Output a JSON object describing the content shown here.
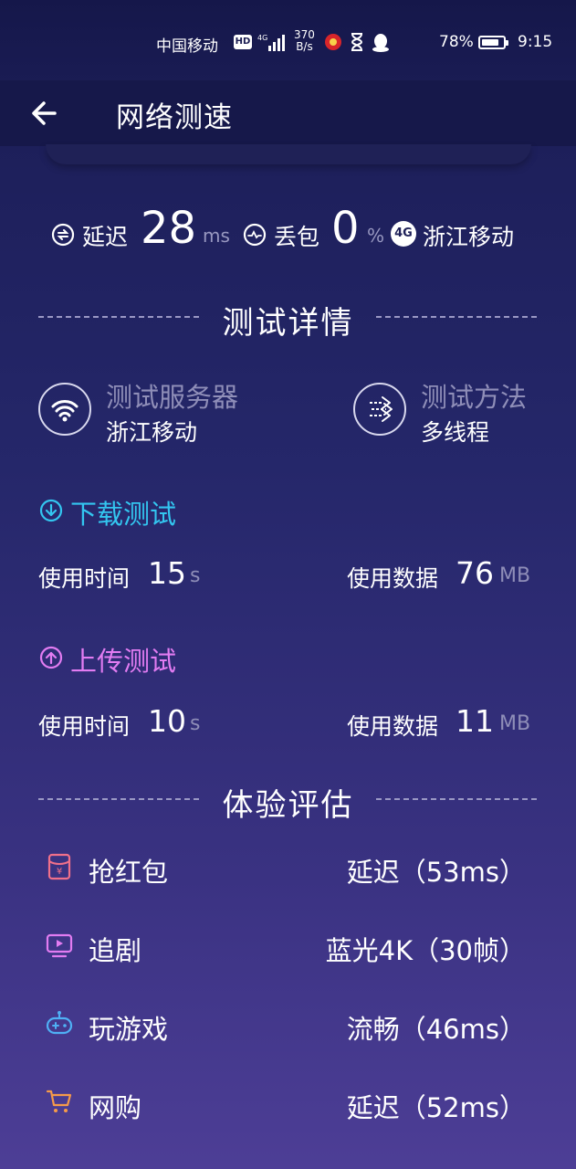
{
  "status_bar": {
    "carrier": "中国移动",
    "hd_badge": "HD",
    "network": "4G",
    "speed_value": "370",
    "speed_unit": "B/s",
    "battery_percent": "78%",
    "time": "9:15"
  },
  "header": {
    "title": "网络测速"
  },
  "metrics": {
    "latency_label": "延迟",
    "latency_value": "28",
    "latency_unit": "ms",
    "packet_loss_label": "丢包",
    "packet_loss_value": "0",
    "packet_loss_unit": "%",
    "network_badge": "4G",
    "operator": "浙江移动"
  },
  "details_section": {
    "title": "测试详情",
    "server_label": "测试服务器",
    "server_value": "浙江移动",
    "method_label": "测试方法",
    "method_value": "多线程"
  },
  "download": {
    "title": "下载测试",
    "color": "#33c6f0",
    "time_label": "使用时间",
    "time_value": "15",
    "time_unit": "s",
    "data_label": "使用数据",
    "data_value": "76",
    "data_unit": "MB"
  },
  "upload": {
    "title": "上传测试",
    "color": "#e27cf2",
    "time_label": "使用时间",
    "time_value": "10",
    "time_unit": "s",
    "data_label": "使用数据",
    "data_value": "11",
    "data_unit": "MB"
  },
  "experience_section": {
    "title": "体验评估",
    "items": [
      {
        "icon": "red-envelope-icon",
        "label": "抢红包",
        "value": "延迟（53ms）",
        "color": "#f0708a"
      },
      {
        "icon": "tv-play-icon",
        "label": "追剧",
        "value": "蓝光4K（30帧）",
        "color": "#e27cf2"
      },
      {
        "icon": "gamepad-icon",
        "label": "玩游戏",
        "value": "流畅（46ms）",
        "color": "#4fb0f5"
      },
      {
        "icon": "cart-icon",
        "label": "网购",
        "value": "延迟（52ms）",
        "color": "#f59a4a"
      }
    ]
  }
}
